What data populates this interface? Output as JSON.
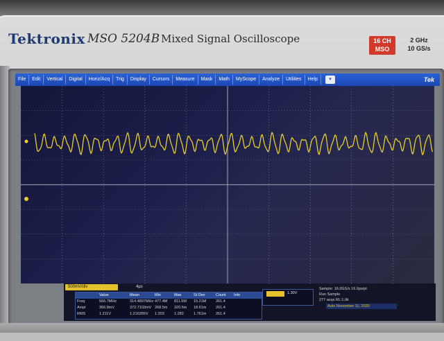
{
  "brand": "Tektronix",
  "model": "MSO 5204B",
  "model_desc": "Mixed Signal Oscilloscope",
  "badge": {
    "line1": "16 CH",
    "line2": "MSO"
  },
  "spec": {
    "line1": "2 GHz",
    "line2": "10 GS/s"
  },
  "menu": [
    "File",
    "Edit",
    "Vertical",
    "Digital",
    "Horiz/Acq",
    "Trig",
    "Display",
    "Cursors",
    "Measure",
    "Mask",
    "Math",
    "MyScope",
    "Analyze",
    "Utilities",
    "Help"
  ],
  "menu_logo": "Tek",
  "channel": {
    "label": "500mV/div",
    "timebase": "4µs"
  },
  "measurements": {
    "headers": [
      "",
      "Value",
      "Mean",
      "Min",
      "Max",
      "St Dev",
      "Count",
      "Info"
    ],
    "rows": [
      [
        "Freq",
        "566.7MHz",
        "314.4897MHz",
        "477.4M",
        "811.5M",
        "15.21M",
        "261.4",
        ""
      ],
      [
        "Ampl",
        "366.8mV",
        "372.7103mV",
        "268.5m",
        "320.6m",
        "18.61m",
        "261.4",
        ""
      ],
      [
        "RMS",
        "1.211V",
        "1.216355V",
        "1.203",
        "1.282",
        "1.761m",
        "261.4",
        ""
      ]
    ]
  },
  "trigger": {
    "value": "1.30V"
  },
  "acquisition": {
    "line1": "Sample: 16.0GS/s  16.0ps/pt",
    "line2": "Run    Sample",
    "line3": "277 acqs         RL:1.0k",
    "line4": "Auto    November 11, 2020"
  },
  "colors": {
    "trace": "#e8cf2e",
    "menu": "#1b47b3",
    "badge": "#d23b2b"
  }
}
